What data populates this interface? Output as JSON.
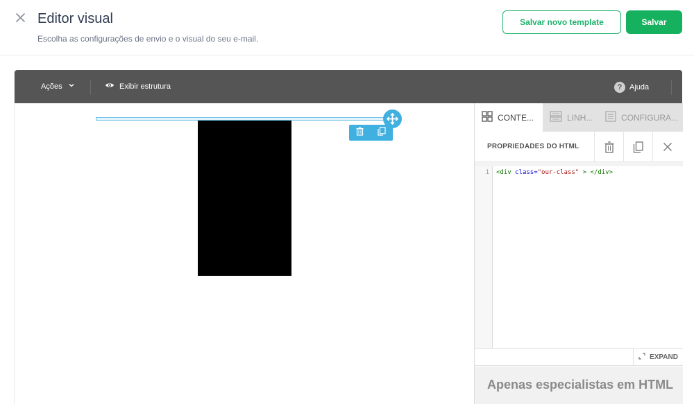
{
  "header": {
    "title": "Editor visual",
    "subtitle": "Escolha as configurações de envio e o visual do seu e-mail.",
    "save_template_label": "Salvar novo template",
    "save_label": "Salvar",
    "accent_color": "#16b15f"
  },
  "toolbar": {
    "actions_label": "Ações",
    "view_structure_label": "Exibir estrutura",
    "help_label": "Ajuda",
    "background_color": "#555556"
  },
  "panel": {
    "tabs": [
      {
        "label": "CONTE...",
        "icon": "grid-icon",
        "active": true
      },
      {
        "label": "LINH...",
        "icon": "rows-icon",
        "active": false
      },
      {
        "label": "CONFIGURA...",
        "icon": "settings-doc-icon",
        "active": false
      }
    ],
    "properties_title": "PROPRIEDADES DO HTML",
    "code": {
      "line_number": "1",
      "tag_open": "<div",
      "attr_name": " class=",
      "attr_value": "\"our-class\"",
      "tag_close": " > </div>"
    },
    "expand_label": "EXPAND",
    "expert_notice": "Apenas especialistas em HTML"
  }
}
